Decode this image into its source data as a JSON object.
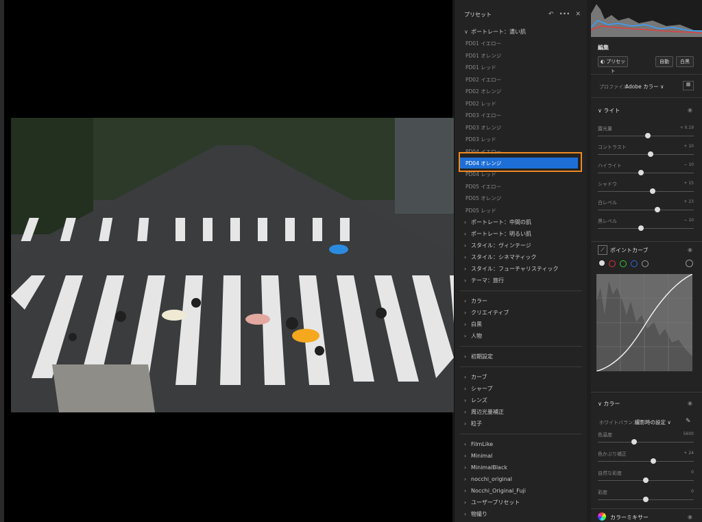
{
  "presets": {
    "title": "プリセット",
    "header_icons": [
      "↶",
      "•••",
      "✕"
    ],
    "groups": [
      {
        "label": "ポートレート：濃い肌",
        "expanded": true,
        "items": [
          "PD01 イエロー",
          "PD01 オレンジ",
          "PD01 レッド",
          "PD02 イエロー",
          "PD02 オレンジ",
          "PD02 レッド",
          "PD03 イエロー",
          "PD03 オレンジ",
          "PD03 レッド",
          "PD04 イエロー",
          "PD04 オレンジ",
          "PD04 レッド",
          "PD05 イエロー",
          "PD05 オレンジ",
          "PD05 レッド"
        ],
        "selected": "PD04 オレンジ"
      },
      {
        "label": "ポートレート：中間の肌"
      },
      {
        "label": "ポートレート：明るい肌"
      },
      {
        "label": "スタイル：ヴィンテージ"
      },
      {
        "label": "スタイル：シネマティック"
      },
      {
        "label": "スタイル：フューチャリスティック"
      },
      {
        "label": "テーマ：旅行"
      }
    ],
    "group2": [
      "カラー",
      "クリエイティブ",
      "白黒",
      "人物"
    ],
    "group3": [
      "初期設定"
    ],
    "group4": [
      "カーブ",
      "シャープ",
      "レンズ",
      "周辺光量補正",
      "粒子"
    ],
    "group5": [
      "FilmLike",
      "Minimal",
      "MinimalBlack",
      "nocchi_original",
      "Nocchi_Original_Fuji",
      "ユーザープリセット",
      "物撮り"
    ]
  },
  "edit": {
    "title": "編集",
    "preset_button": "プリセット",
    "auto_button": "自動",
    "bw_button": "白黒",
    "profile_label": "プロファイル",
    "profile_value": "Adobe カラー",
    "light": {
      "title": "ライト",
      "sliders": [
        {
          "name": "露光量",
          "value": "+ 0.19",
          "pos": 0.52
        },
        {
          "name": "コントラスト",
          "value": "+ 10",
          "pos": 0.55
        },
        {
          "name": "ハイライト",
          "value": "− 10",
          "pos": 0.45
        },
        {
          "name": "シャドウ",
          "value": "+ 15",
          "pos": 0.57
        },
        {
          "name": "白レベル",
          "value": "+ 23",
          "pos": 0.62
        },
        {
          "name": "黒レベル",
          "value": "− 10",
          "pos": 0.45
        }
      ]
    },
    "point_curve": {
      "title": "ポイントカーブ"
    },
    "color": {
      "title": "カラー",
      "wb_label": "ホワイトバランス",
      "wb_value": "撮影時の設定",
      "sliders": [
        {
          "name": "色温度",
          "value": "5600",
          "pos": 0.38
        },
        {
          "name": "色かぶり補正",
          "value": "+ 24",
          "pos": 0.58
        },
        {
          "name": "自然な彩度",
          "value": "0",
          "pos": 0.5
        },
        {
          "name": "彩度",
          "value": "0",
          "pos": 0.5
        }
      ]
    },
    "color_mixer": {
      "title": "カラーミキサー"
    }
  },
  "colors": {
    "accent": "#1d6fd6",
    "highlight": "#f08a24"
  }
}
